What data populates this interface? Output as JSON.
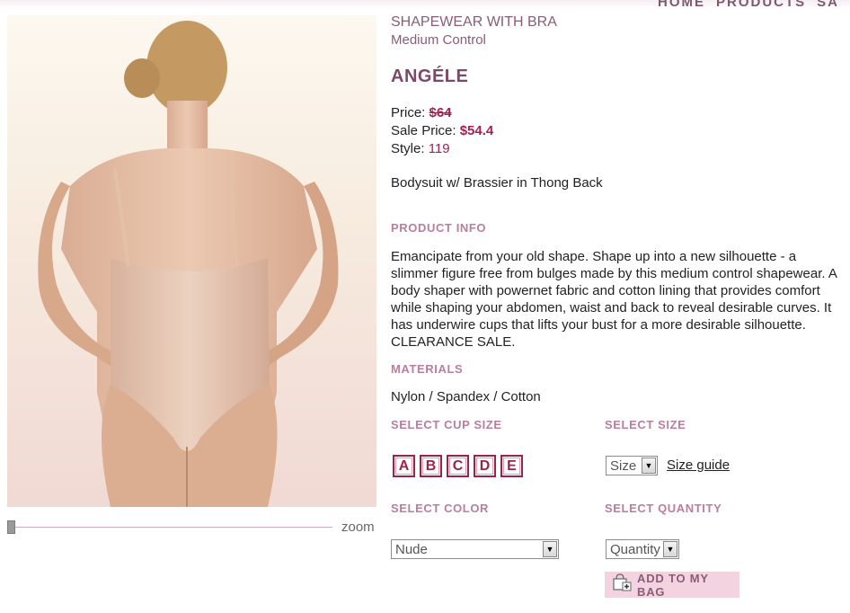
{
  "nav": {
    "items": [
      "HOME",
      "PRODUCTS",
      "SA"
    ]
  },
  "product": {
    "category": "SHAPEWEAR WITH BRA",
    "control": "Medium Control",
    "name": "ANGÉLE",
    "price_label": "Price:",
    "price": "$64",
    "sale_label": "Sale Price:",
    "sale_price": "$54.4",
    "style_label": "Style:",
    "style": "119",
    "subtitle": "Bodysuit w/ Brassier in Thong Back"
  },
  "info": {
    "heading": "PRODUCT INFO",
    "text": "Emancipate from your old shape. Shape up into a new silhouette - a slimmer figure free from bulges made by this medium control shapewear. A body shaper with powernet fabric and cotton lining that provides comfort while shaping your abdomen, waist and back to reveal desirable curves. It has underwire cups that lifts your bust for a more desirable silhouette. CLEARANCE SALE."
  },
  "materials": {
    "heading": "MATERIALS",
    "text": "Nylon / Spandex / Cotton"
  },
  "cup": {
    "heading": "SELECT CUP SIZE",
    "options": [
      "A",
      "B",
      "C",
      "D",
      "E"
    ]
  },
  "size": {
    "heading": "SELECT  SIZE",
    "value": "Size",
    "guide": "Size guide"
  },
  "color": {
    "heading": "SELECT COLOR",
    "value": "Nude"
  },
  "quantity": {
    "heading": "SELECT QUANTITY",
    "value": "Quantity"
  },
  "cart": {
    "add_label": "ADD TO MY BAG"
  },
  "zoom": {
    "label": "zoom"
  },
  "icons": {
    "bag": "shopping-bag-add-icon",
    "dropdown": "dropdown-arrow-icon"
  },
  "colors": {
    "accent": "#9a2448",
    "heading": "#b97e9e",
    "title": "#7b4a68",
    "button_bg": "#f3d3e0"
  }
}
